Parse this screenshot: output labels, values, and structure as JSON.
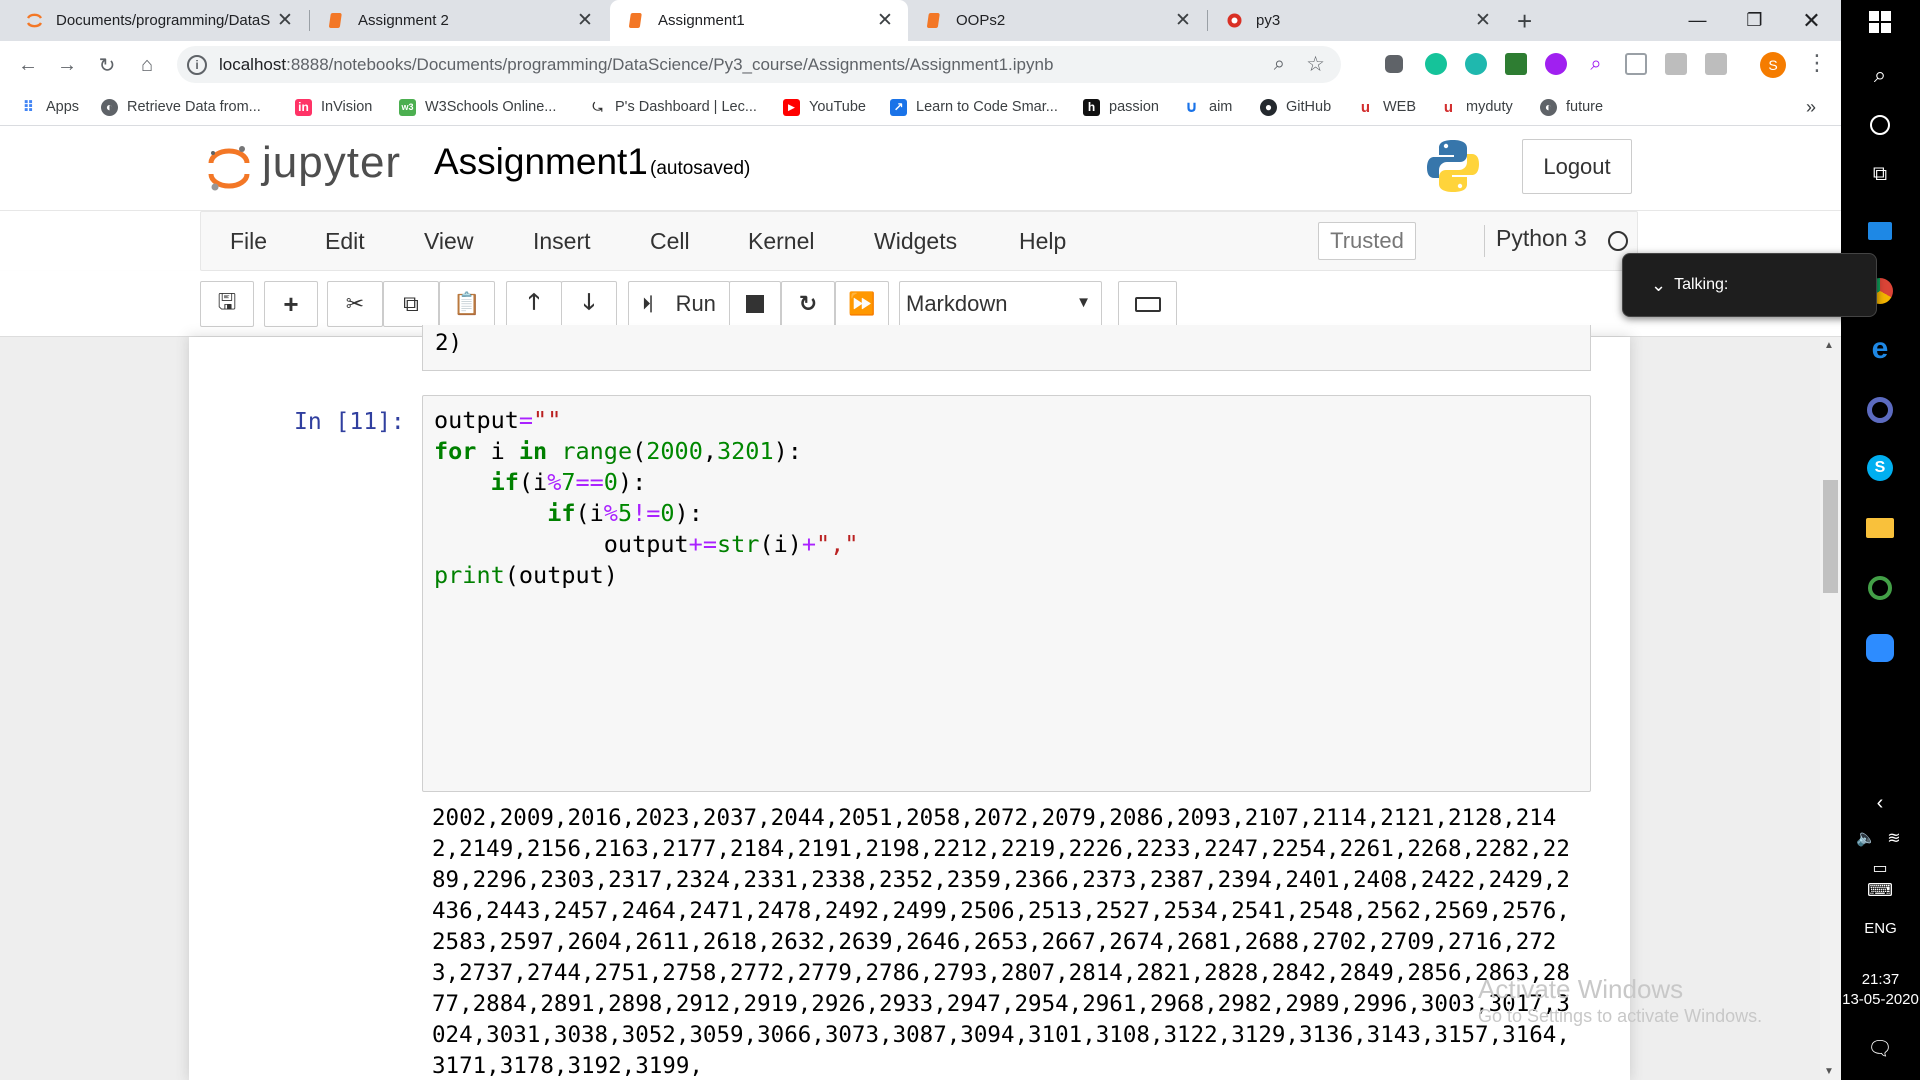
{
  "browser": {
    "tabs": [
      {
        "title": "Documents/programming/DataS",
        "active": false
      },
      {
        "title": "Assignment 2",
        "active": false
      },
      {
        "title": "Assignment1",
        "active": true
      },
      {
        "title": "OOPs2",
        "active": false
      },
      {
        "title": "py3",
        "active": false
      }
    ],
    "new_tab": "+",
    "url_host": "localhost",
    "url_path": ":8888/notebooks/Documents/programming/DataScience/Py3_course/Assignments/Assignment1.ipynb",
    "profile_initial": "S",
    "bookmarks": [
      {
        "label": "Apps",
        "icon": "apps-grid-icon"
      },
      {
        "label": "Retrieve Data from...",
        "icon": "globe-icon"
      },
      {
        "label": "InVision",
        "icon": "invision-icon"
      },
      {
        "label": "W3Schools Online...",
        "icon": "w3schools-icon"
      },
      {
        "label": "P's Dashboard | Lec...",
        "icon": "leetcode-icon"
      },
      {
        "label": "YouTube",
        "icon": "youtube-icon"
      },
      {
        "label": "Learn to Code Smar...",
        "icon": "code-icon"
      },
      {
        "label": "passion",
        "icon": "hashnode-icon"
      },
      {
        "label": "aim",
        "icon": "udemy-icon"
      },
      {
        "label": "GitHub",
        "icon": "github-icon"
      },
      {
        "label": "WEB",
        "icon": "udacity-icon"
      },
      {
        "label": "myduty",
        "icon": "udacity-icon"
      },
      {
        "label": "future",
        "icon": "globe-icon"
      }
    ],
    "more_bookmarks": "»"
  },
  "jupyter": {
    "logo_text": "jupyter",
    "notebook_name": "Assignment1",
    "autosave": "(autosaved)",
    "logout": "Logout",
    "menus": [
      "File",
      "Edit",
      "View",
      "Insert",
      "Cell",
      "Kernel",
      "Widgets",
      "Help"
    ],
    "trusted": "Trusted",
    "kernel_name": "Python 3",
    "run_label": "Run",
    "cell_type": "Markdown"
  },
  "notebook": {
    "prev_cell_tail": "2)",
    "prompt": "In [11]:",
    "output": "2002,2009,2016,2023,2037,2044,2051,2058,2072,2079,2086,2093,2107,2114,2121,2128,2142,2149,2156,2163,2177,2184,2191,2198,2212,2219,2226,2233,2247,2254,2261,2268,2282,2289,2296,2303,2317,2324,2331,2338,2352,2359,2366,2373,2387,2394,2401,2408,2422,2429,2436,2443,2457,2464,2471,2478,2492,2499,2506,2513,2527,2534,2541,2548,2562,2569,2576,2583,2597,2604,2611,2618,2632,2639,2646,2653,2667,2674,2681,2688,2702,2709,2716,2723,2737,2744,2751,2758,2772,2779,2786,2793,2807,2814,2821,2828,2842,2849,2856,2863,2877,2884,2891,2898,2912,2919,2926,2933,2947,2954,2961,2968,2982,2989,2996,3003,3017,3024,3031,3038,3052,3059,3066,3073,3087,3094,3101,3108,3122,3129,3136,3143,3157,3164,3171,3178,3192,3199,"
  },
  "overlay": {
    "talking": "Talking:",
    "watermark_title": "Activate Windows",
    "watermark_sub": "Go to Settings to activate Windows."
  },
  "taskbar": {
    "lang": "ENG",
    "time": "21:37",
    "date": "13-05-2020"
  }
}
